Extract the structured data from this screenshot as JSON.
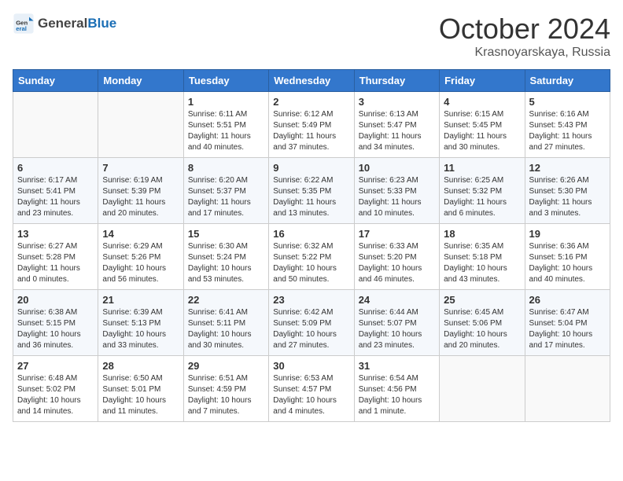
{
  "header": {
    "logo_general": "General",
    "logo_blue": "Blue",
    "month_title": "October 2024",
    "location": "Krasnoyarskaya, Russia"
  },
  "days_of_week": [
    "Sunday",
    "Monday",
    "Tuesday",
    "Wednesday",
    "Thursday",
    "Friday",
    "Saturday"
  ],
  "weeks": [
    [
      {
        "day": "",
        "content": ""
      },
      {
        "day": "",
        "content": ""
      },
      {
        "day": "1",
        "content": "Sunrise: 6:11 AM\nSunset: 5:51 PM\nDaylight: 11 hours and 40 minutes."
      },
      {
        "day": "2",
        "content": "Sunrise: 6:12 AM\nSunset: 5:49 PM\nDaylight: 11 hours and 37 minutes."
      },
      {
        "day": "3",
        "content": "Sunrise: 6:13 AM\nSunset: 5:47 PM\nDaylight: 11 hours and 34 minutes."
      },
      {
        "day": "4",
        "content": "Sunrise: 6:15 AM\nSunset: 5:45 PM\nDaylight: 11 hours and 30 minutes."
      },
      {
        "day": "5",
        "content": "Sunrise: 6:16 AM\nSunset: 5:43 PM\nDaylight: 11 hours and 27 minutes."
      }
    ],
    [
      {
        "day": "6",
        "content": "Sunrise: 6:17 AM\nSunset: 5:41 PM\nDaylight: 11 hours and 23 minutes."
      },
      {
        "day": "7",
        "content": "Sunrise: 6:19 AM\nSunset: 5:39 PM\nDaylight: 11 hours and 20 minutes."
      },
      {
        "day": "8",
        "content": "Sunrise: 6:20 AM\nSunset: 5:37 PM\nDaylight: 11 hours and 17 minutes."
      },
      {
        "day": "9",
        "content": "Sunrise: 6:22 AM\nSunset: 5:35 PM\nDaylight: 11 hours and 13 minutes."
      },
      {
        "day": "10",
        "content": "Sunrise: 6:23 AM\nSunset: 5:33 PM\nDaylight: 11 hours and 10 minutes."
      },
      {
        "day": "11",
        "content": "Sunrise: 6:25 AM\nSunset: 5:32 PM\nDaylight: 11 hours and 6 minutes."
      },
      {
        "day": "12",
        "content": "Sunrise: 6:26 AM\nSunset: 5:30 PM\nDaylight: 11 hours and 3 minutes."
      }
    ],
    [
      {
        "day": "13",
        "content": "Sunrise: 6:27 AM\nSunset: 5:28 PM\nDaylight: 11 hours and 0 minutes."
      },
      {
        "day": "14",
        "content": "Sunrise: 6:29 AM\nSunset: 5:26 PM\nDaylight: 10 hours and 56 minutes."
      },
      {
        "day": "15",
        "content": "Sunrise: 6:30 AM\nSunset: 5:24 PM\nDaylight: 10 hours and 53 minutes."
      },
      {
        "day": "16",
        "content": "Sunrise: 6:32 AM\nSunset: 5:22 PM\nDaylight: 10 hours and 50 minutes."
      },
      {
        "day": "17",
        "content": "Sunrise: 6:33 AM\nSunset: 5:20 PM\nDaylight: 10 hours and 46 minutes."
      },
      {
        "day": "18",
        "content": "Sunrise: 6:35 AM\nSunset: 5:18 PM\nDaylight: 10 hours and 43 minutes."
      },
      {
        "day": "19",
        "content": "Sunrise: 6:36 AM\nSunset: 5:16 PM\nDaylight: 10 hours and 40 minutes."
      }
    ],
    [
      {
        "day": "20",
        "content": "Sunrise: 6:38 AM\nSunset: 5:15 PM\nDaylight: 10 hours and 36 minutes."
      },
      {
        "day": "21",
        "content": "Sunrise: 6:39 AM\nSunset: 5:13 PM\nDaylight: 10 hours and 33 minutes."
      },
      {
        "day": "22",
        "content": "Sunrise: 6:41 AM\nSunset: 5:11 PM\nDaylight: 10 hours and 30 minutes."
      },
      {
        "day": "23",
        "content": "Sunrise: 6:42 AM\nSunset: 5:09 PM\nDaylight: 10 hours and 27 minutes."
      },
      {
        "day": "24",
        "content": "Sunrise: 6:44 AM\nSunset: 5:07 PM\nDaylight: 10 hours and 23 minutes."
      },
      {
        "day": "25",
        "content": "Sunrise: 6:45 AM\nSunset: 5:06 PM\nDaylight: 10 hours and 20 minutes."
      },
      {
        "day": "26",
        "content": "Sunrise: 6:47 AM\nSunset: 5:04 PM\nDaylight: 10 hours and 17 minutes."
      }
    ],
    [
      {
        "day": "27",
        "content": "Sunrise: 6:48 AM\nSunset: 5:02 PM\nDaylight: 10 hours and 14 minutes."
      },
      {
        "day": "28",
        "content": "Sunrise: 6:50 AM\nSunset: 5:01 PM\nDaylight: 10 hours and 11 minutes."
      },
      {
        "day": "29",
        "content": "Sunrise: 6:51 AM\nSunset: 4:59 PM\nDaylight: 10 hours and 7 minutes."
      },
      {
        "day": "30",
        "content": "Sunrise: 6:53 AM\nSunset: 4:57 PM\nDaylight: 10 hours and 4 minutes."
      },
      {
        "day": "31",
        "content": "Sunrise: 6:54 AM\nSunset: 4:56 PM\nDaylight: 10 hours and 1 minute."
      },
      {
        "day": "",
        "content": ""
      },
      {
        "day": "",
        "content": ""
      }
    ]
  ]
}
